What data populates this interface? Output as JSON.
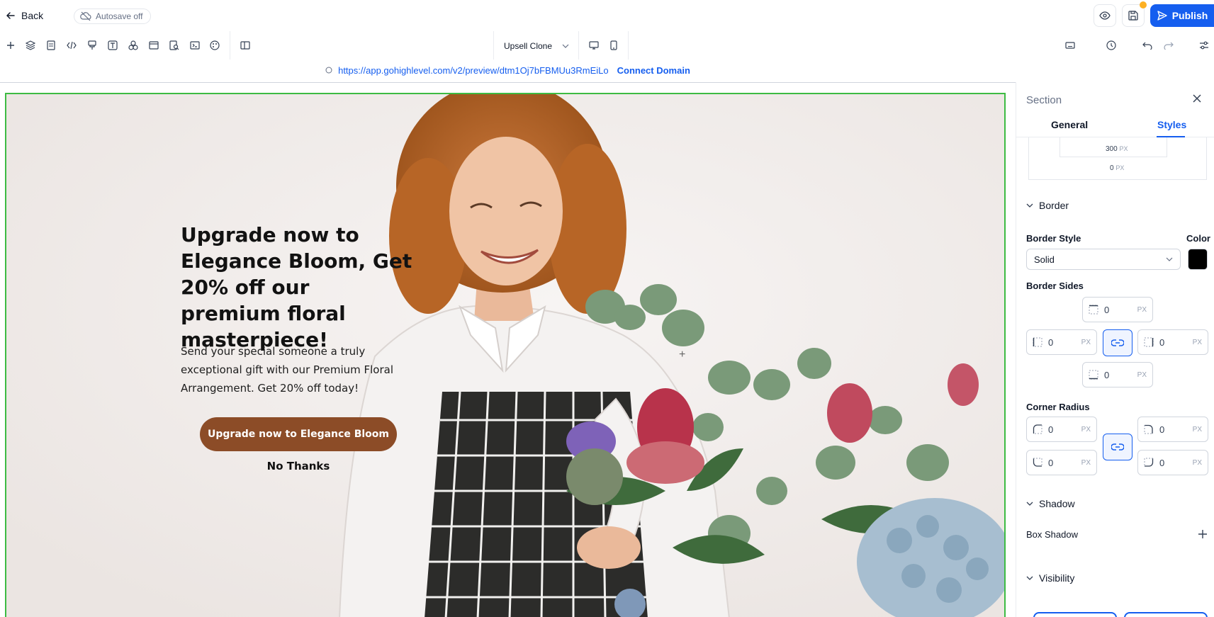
{
  "topbar": {
    "back_label": "Back",
    "autosave_label": "Autosave off",
    "publish_label": "Publish"
  },
  "toolbar": {
    "page_name": "Upsell Clone"
  },
  "urlbar": {
    "url": "https://app.gohighlevel.com/v2/preview/dtm1Oj7bFBMUu3RmEiLo",
    "connect_label": "Connect Domain"
  },
  "canvas": {
    "headline": "Upgrade now to Elegance Bloom, Get 20% off our premium floral masterpiece!",
    "subtext": "Send your special someone a truly exceptional gift with our Premium Floral Arrangement. Get 20% off today!",
    "cta_label": "Upgrade now to Elegance Bloom",
    "decline_label": "No Thanks"
  },
  "panel": {
    "title": "Section",
    "tabs": {
      "general": "General",
      "styles": "Styles"
    },
    "spacing": {
      "inner_value": "300",
      "outer_value": "0",
      "unit": "PX"
    },
    "border": {
      "heading": "Border",
      "style_label": "Border Style",
      "color_label": "Color",
      "style_value": "Solid",
      "color": "#000000",
      "sides_label": "Border Sides",
      "top": "0",
      "left": "0",
      "right": "0",
      "bottom": "0",
      "unit": "PX"
    },
    "corner_radius": {
      "label": "Corner Radius",
      "top_left": "0",
      "top_right": "0",
      "bottom_left": "0",
      "bottom_right": "0",
      "unit": "PX"
    },
    "shadow": {
      "heading": "Shadow",
      "box_shadow_label": "Box Shadow"
    },
    "visibility": {
      "heading": "Visibility"
    }
  },
  "colors": {
    "accent": "#155eef",
    "cta": "#8c4c27",
    "selection": "#3dbb43",
    "notification_dot": "#fdb022"
  }
}
